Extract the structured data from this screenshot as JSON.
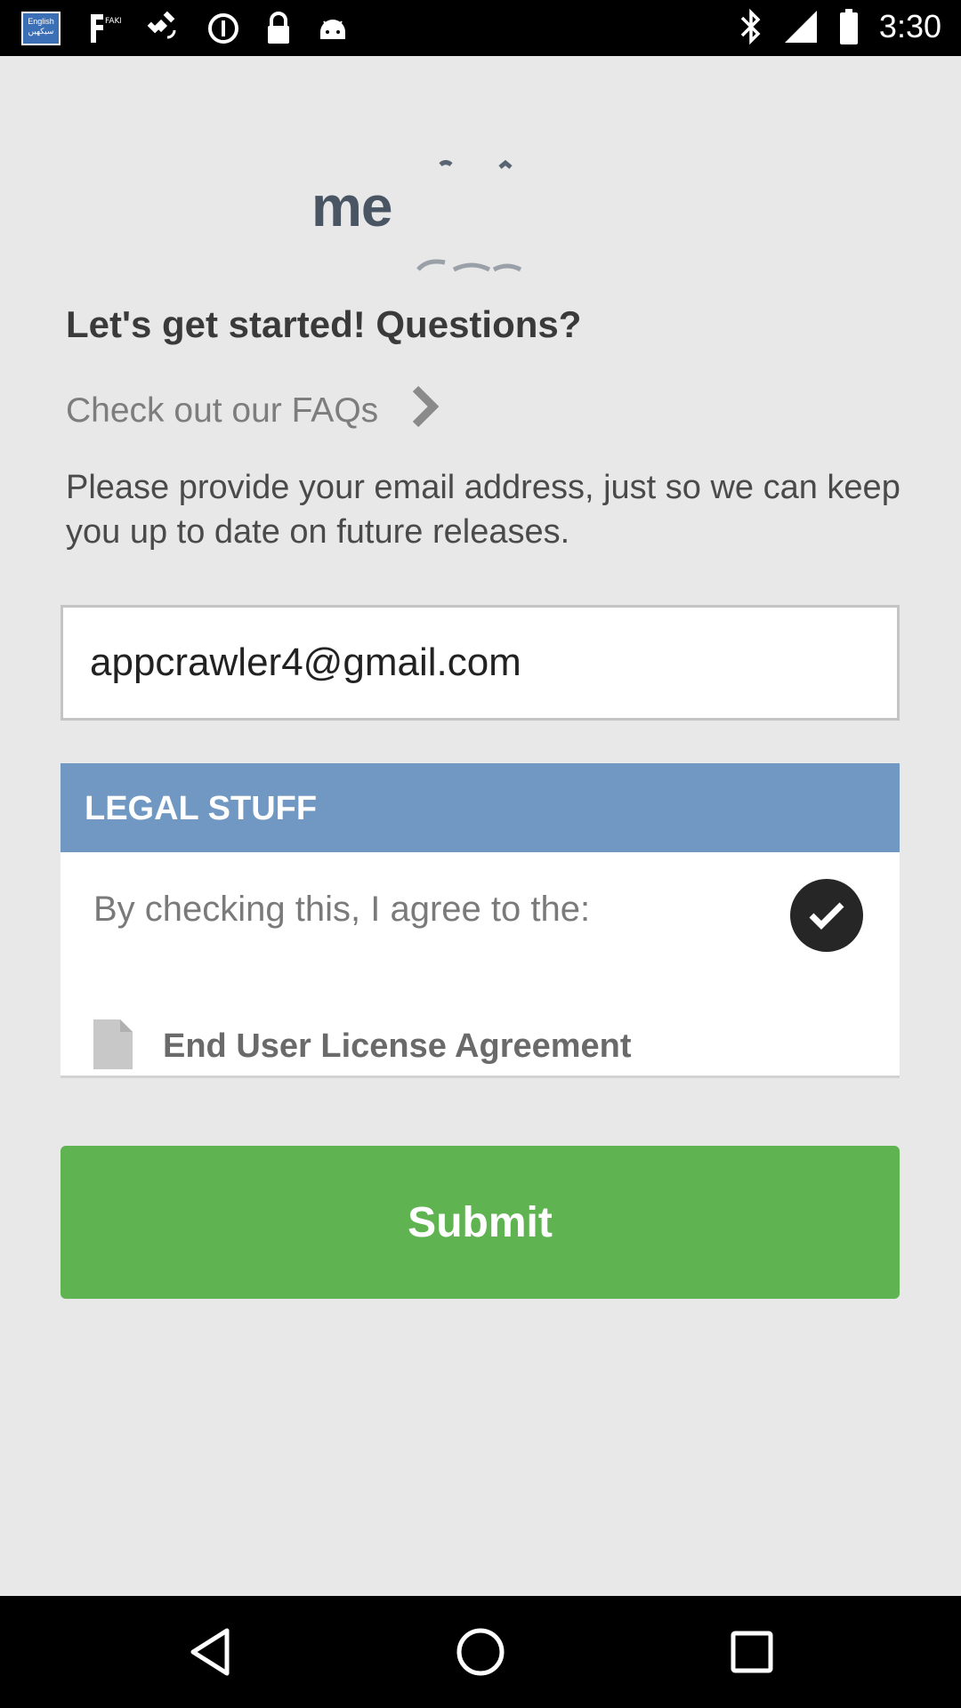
{
  "status_bar": {
    "language_badge_top": "English",
    "language_badge_bottom": "سیکھیں",
    "time": "3:30",
    "icons": [
      "language-badge-icon",
      "fake-gps-icon",
      "satellite-icon",
      "data-saver-icon",
      "lock-icon",
      "android-icon",
      "bluetooth-icon",
      "signal-icon",
      "battery-icon"
    ]
  },
  "logo": {
    "text": "me"
  },
  "main": {
    "heading": "Let's get started! Questions?",
    "faq_link_label": "Check out our FAQs",
    "description": "Please provide your email address, just so we can keep you up to date on future releases.",
    "email_value": "appcrawler4@gmail.com"
  },
  "legal": {
    "header": "LEGAL STUFF",
    "agree_text": "By checking this, I agree to the:",
    "agreement_checked": true,
    "eula_label": "End User License Agreement"
  },
  "submit_label": "Submit",
  "colors": {
    "legal_header": "#7098c2",
    "submit": "#5fb351",
    "check": "#262626"
  }
}
